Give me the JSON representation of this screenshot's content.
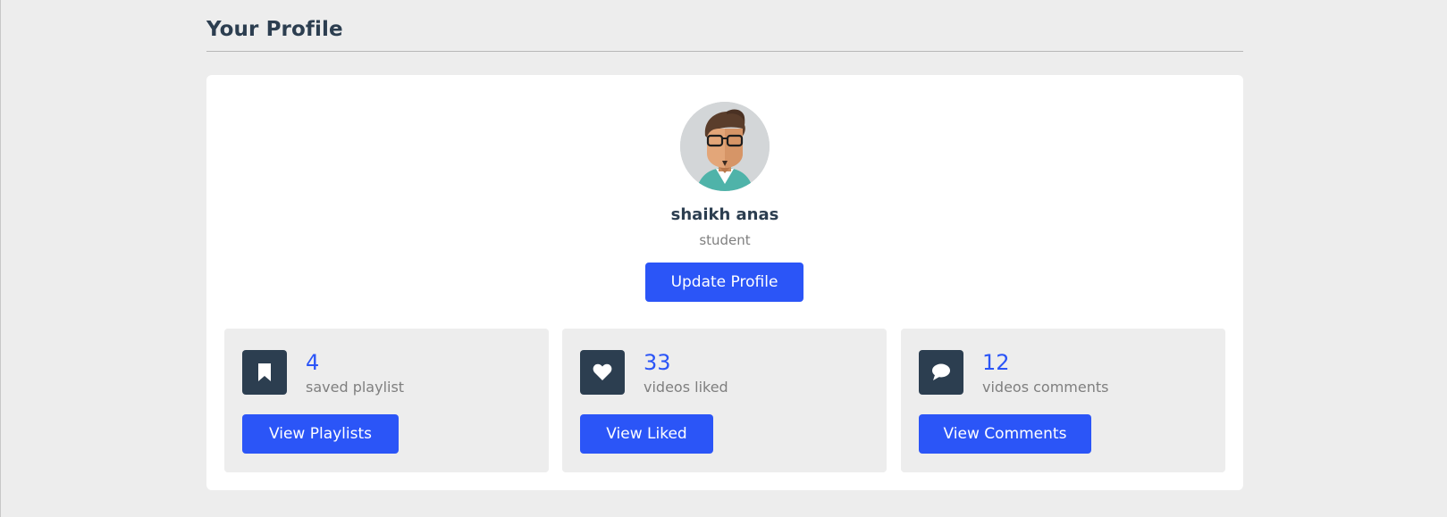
{
  "page": {
    "title": "Your Profile"
  },
  "profile": {
    "name": "shaikh anas",
    "role": "student",
    "update_button": "Update Profile"
  },
  "stats": [
    {
      "icon": "bookmark-icon",
      "count": "4",
      "label": "saved playlist",
      "button": "View Playlists"
    },
    {
      "icon": "heart-icon",
      "count": "33",
      "label": "videos liked",
      "button": "View Liked"
    },
    {
      "icon": "comment-icon",
      "count": "12",
      "label": "videos comments",
      "button": "View Comments"
    }
  ],
  "colors": {
    "background": "#ededed",
    "card": "#ffffff",
    "accent": "#2b55f7",
    "dark": "#2c3e50",
    "muted": "#7f7f7f"
  }
}
